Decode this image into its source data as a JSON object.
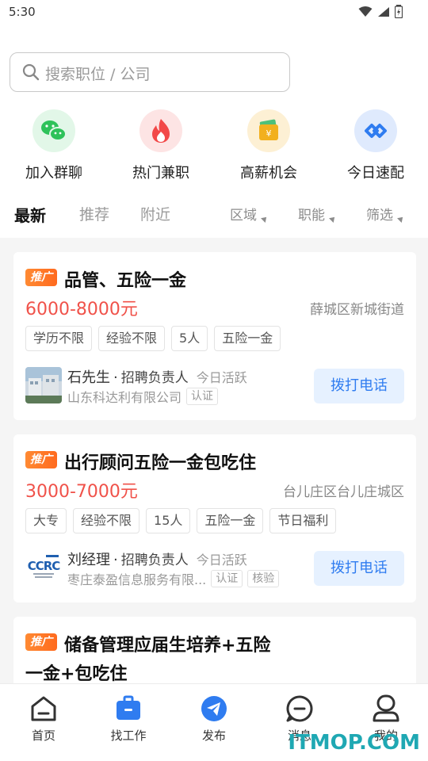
{
  "status_bar": {
    "time": "5:30"
  },
  "search": {
    "placeholder": "搜索职位 / 公司"
  },
  "quick_actions": [
    {
      "label": "加入群聊",
      "icon": "wechat-icon",
      "color": "#2ec25a"
    },
    {
      "label": "热门兼职",
      "icon": "fire-icon",
      "color": "#f24848"
    },
    {
      "label": "高薪机会",
      "icon": "money-envelope-icon",
      "color": "#f2b01e"
    },
    {
      "label": "今日速配",
      "icon": "match-icon",
      "color": "#2f7cf0"
    }
  ],
  "tabs": [
    "最新",
    "推荐",
    "附近"
  ],
  "filters": [
    "区域",
    "职能",
    "筛选"
  ],
  "jobs": [
    {
      "ad_label": "推广",
      "title": "品管、五险一金",
      "salary": "6000-8000元",
      "location": "薛城区新城街道",
      "tags": [
        "学历不限",
        "经验不限",
        "5人",
        "五险一金"
      ],
      "recruiter": "石先生",
      "role": "招聘负责人",
      "activity": "今日活跃",
      "company": "山东科达利有限公司",
      "badges": [
        "认证"
      ],
      "call_label": "拨打电话"
    },
    {
      "ad_label": "推广",
      "title": "出行顾问五险一金包吃住",
      "salary": "3000-7000元",
      "location": "台儿庄区台儿庄城区",
      "tags": [
        "大专",
        "经验不限",
        "15人",
        "五险一金",
        "节日福利"
      ],
      "recruiter": "刘经理",
      "role": "招聘负责人",
      "activity": "今日活跃",
      "company": "枣庄泰盈信息服务有限...",
      "badges": [
        "认证",
        "核验"
      ],
      "call_label": "拨打电话"
    },
    {
      "ad_label": "推广",
      "title_line1": "储备管理应届生培养+五险",
      "title_line2": "一金+包吃住"
    }
  ],
  "bottom_nav": [
    {
      "label": "首页",
      "icon": "home-icon"
    },
    {
      "label": "找工作",
      "icon": "briefcase-icon",
      "active": true
    },
    {
      "label": "发布",
      "icon": "send-icon"
    },
    {
      "label": "消息",
      "icon": "message-icon"
    },
    {
      "label": "我的",
      "icon": "profile-icon"
    }
  ],
  "watermark": "ITMOP.COM"
}
